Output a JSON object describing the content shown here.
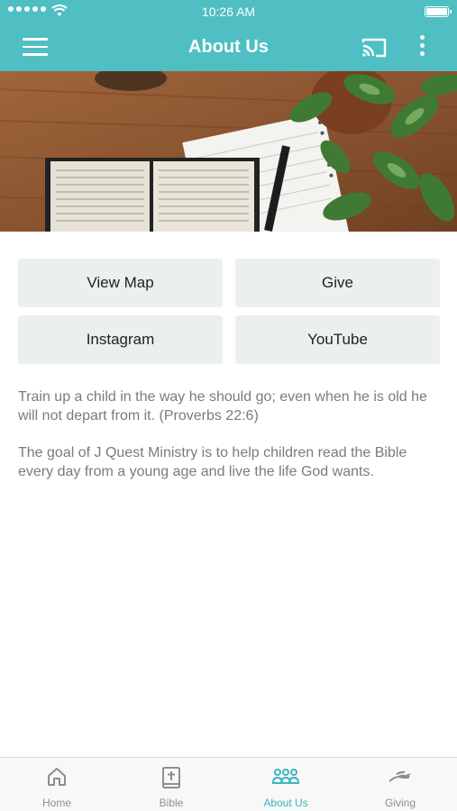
{
  "status_bar": {
    "time": "10:26 AM"
  },
  "header": {
    "title": "About Us",
    "menu_icon": "hamburger-menu-icon",
    "cast_icon": "cast-icon",
    "more_icon": "more-vertical-icon"
  },
  "hero": {
    "description": "photo: open Bible, notebook with pen, and potted plant on wooden table"
  },
  "buttons": [
    {
      "label": "View Map"
    },
    {
      "label": "Give"
    },
    {
      "label": "Instagram"
    },
    {
      "label": "YouTube"
    }
  ],
  "content": {
    "verse": "Train up a child in the way he should go; even when he is old he will not depart from it. (Proverbs 22:6)",
    "mission": "The goal of J Quest Ministry is to help children read the Bible every day from a young age and live the life God wants."
  },
  "tabs": [
    {
      "label": "Home",
      "icon": "home-icon",
      "active": false
    },
    {
      "label": "Bible",
      "icon": "bible-icon",
      "active": false
    },
    {
      "label": "About Us",
      "icon": "group-icon",
      "active": true
    },
    {
      "label": "Giving",
      "icon": "giving-hand-icon",
      "active": false
    }
  ],
  "colors": {
    "accent": "#4fbfc4",
    "active_tab": "#3eb6bc",
    "button_bg": "#eceff0",
    "body_text": "#7b7b7b"
  }
}
